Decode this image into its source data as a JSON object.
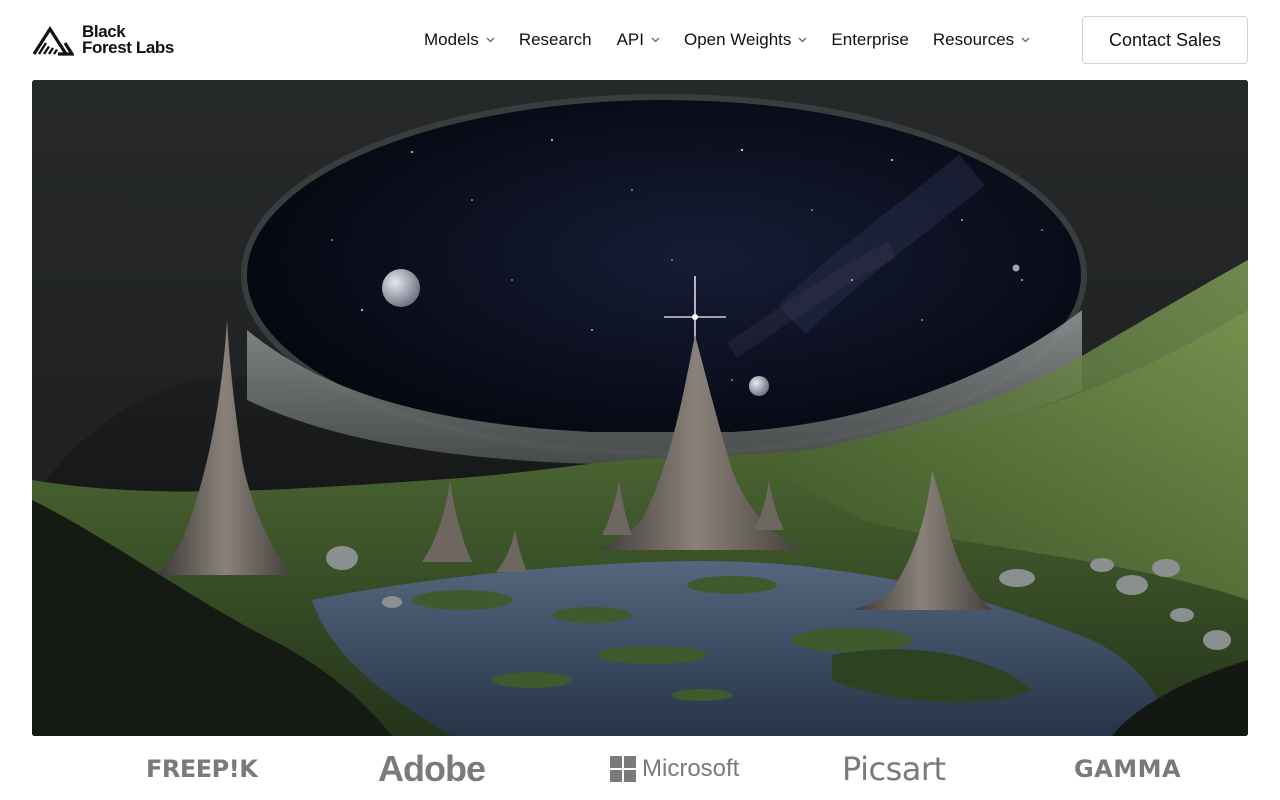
{
  "brand": {
    "name_line1": "Black",
    "name_line2": "Forest Labs",
    "logo_icon": "triangle-stripes-logo"
  },
  "nav": {
    "items": [
      {
        "label": "Models",
        "has_dropdown": true
      },
      {
        "label": "Research",
        "has_dropdown": false
      },
      {
        "label": "API",
        "has_dropdown": true
      },
      {
        "label": "Open Weights",
        "has_dropdown": true
      },
      {
        "label": "Enterprise",
        "has_dropdown": false
      },
      {
        "label": "Resources",
        "has_dropdown": true
      }
    ],
    "dropdown_icon": "chevron-down-icon"
  },
  "cta": {
    "contact_label": "Contact Sales"
  },
  "hero": {
    "image_subject": "cavern-opening-to-starry-sky-with-planets-and-spires"
  },
  "partners": {
    "logos": [
      "FREEP!K",
      "Adobe",
      "Microsoft",
      "Picsart",
      "GAMMA"
    ]
  },
  "colors": {
    "text": "#111111",
    "partner_logo_gray": "#7a7a7a",
    "button_border": "#d2d2d2",
    "sky": "#0b0f1e",
    "moss": "#4a6b2a"
  }
}
